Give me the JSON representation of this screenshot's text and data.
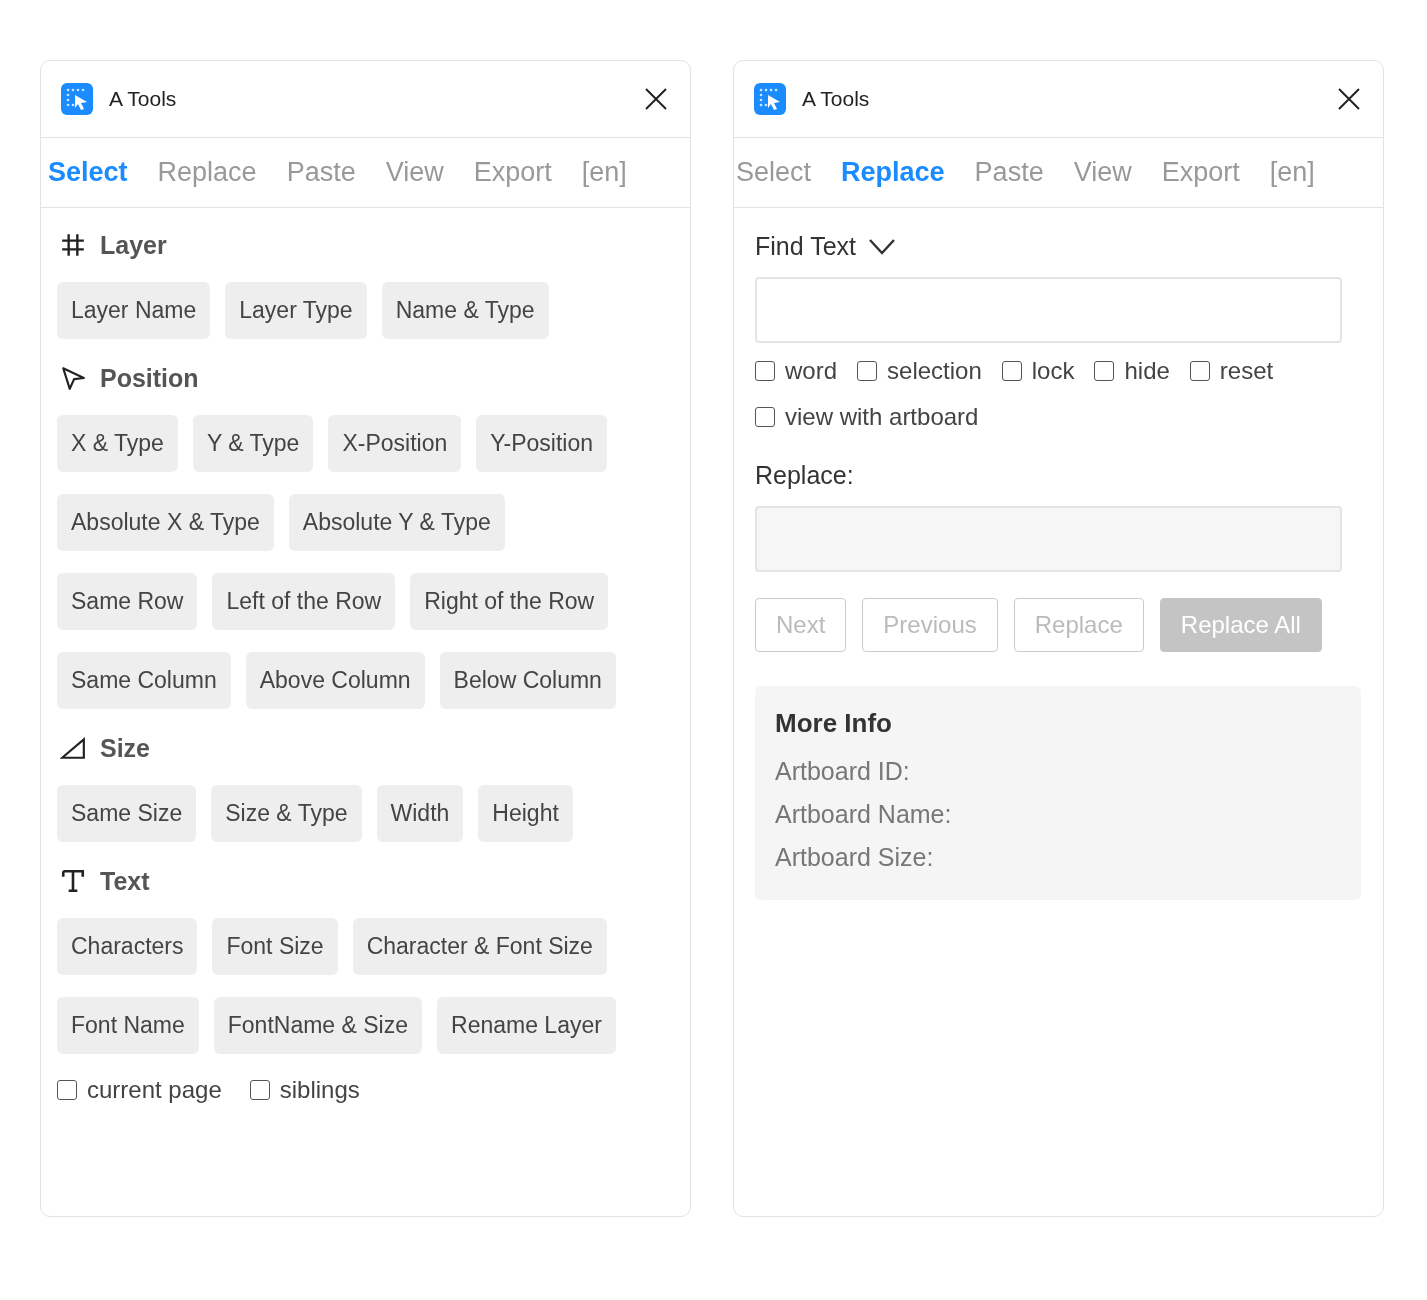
{
  "panels": [
    {
      "kind": "select",
      "title": "A Tools",
      "tabs": [
        {
          "label": "Select",
          "selected": true
        },
        {
          "label": "Replace",
          "selected": false
        },
        {
          "label": "Paste",
          "selected": false
        },
        {
          "label": "View",
          "selected": false
        },
        {
          "label": "Export",
          "selected": false
        },
        {
          "label": "[en]",
          "selected": false
        }
      ],
      "sections": [
        {
          "kind": "hash",
          "title": "Layer",
          "rows": [
            [
              "Layer Name",
              "Layer Type",
              "Name & Type"
            ]
          ]
        },
        {
          "kind": "pointer",
          "title": "Position",
          "rows": [
            [
              "X & Type",
              "Y & Type",
              "X-Position",
              "Y-Position"
            ],
            [
              "Absolute X & Type",
              "Absolute Y & Type"
            ],
            [
              "Same Row",
              "Left of the Row",
              "Right of the Row"
            ],
            [
              "Same Column",
              "Above Column",
              "Below Column"
            ]
          ]
        },
        {
          "kind": "triangle",
          "title": "Size",
          "rows": [
            [
              "Same Size",
              "Size & Type",
              "Width",
              "Height"
            ]
          ]
        },
        {
          "kind": "text",
          "title": "Text",
          "rows": [
            [
              "Characters",
              "Font Size",
              "Character & Font Size"
            ],
            [
              "Font Name",
              "FontName & Size",
              "Rename Layer"
            ]
          ]
        }
      ],
      "options": [
        {
          "label": "current page",
          "checked": false
        },
        {
          "label": "siblings",
          "checked": false
        }
      ]
    },
    {
      "kind": "replace",
      "title": "A Tools",
      "tabs": [
        {
          "label": "Select",
          "selected": false
        },
        {
          "label": "Replace",
          "selected": true
        },
        {
          "label": "Paste",
          "selected": false
        },
        {
          "label": "View",
          "selected": false
        },
        {
          "label": "Export",
          "selected": false
        },
        {
          "label": "[en]",
          "selected": false
        }
      ],
      "find_label": "Find Text",
      "options": [
        {
          "label": "word",
          "checked": false
        },
        {
          "label": "selection",
          "checked": false
        },
        {
          "label": "lock",
          "checked": false
        },
        {
          "label": "hide",
          "checked": false
        },
        {
          "label": "reset",
          "checked": false
        },
        {
          "label": "view with artboard",
          "checked": false
        }
      ],
      "replace_label": "Replace:",
      "buttons": [
        {
          "label": "Next",
          "kind": "outline"
        },
        {
          "label": "Previous",
          "kind": "outline"
        },
        {
          "label": "Replace",
          "kind": "outline"
        },
        {
          "label": "Replace All",
          "kind": "filled"
        }
      ],
      "info": {
        "title": "More Info",
        "lines": [
          "Artboard ID:",
          "Artboard Name:",
          "Artboard Size:"
        ]
      }
    }
  ]
}
